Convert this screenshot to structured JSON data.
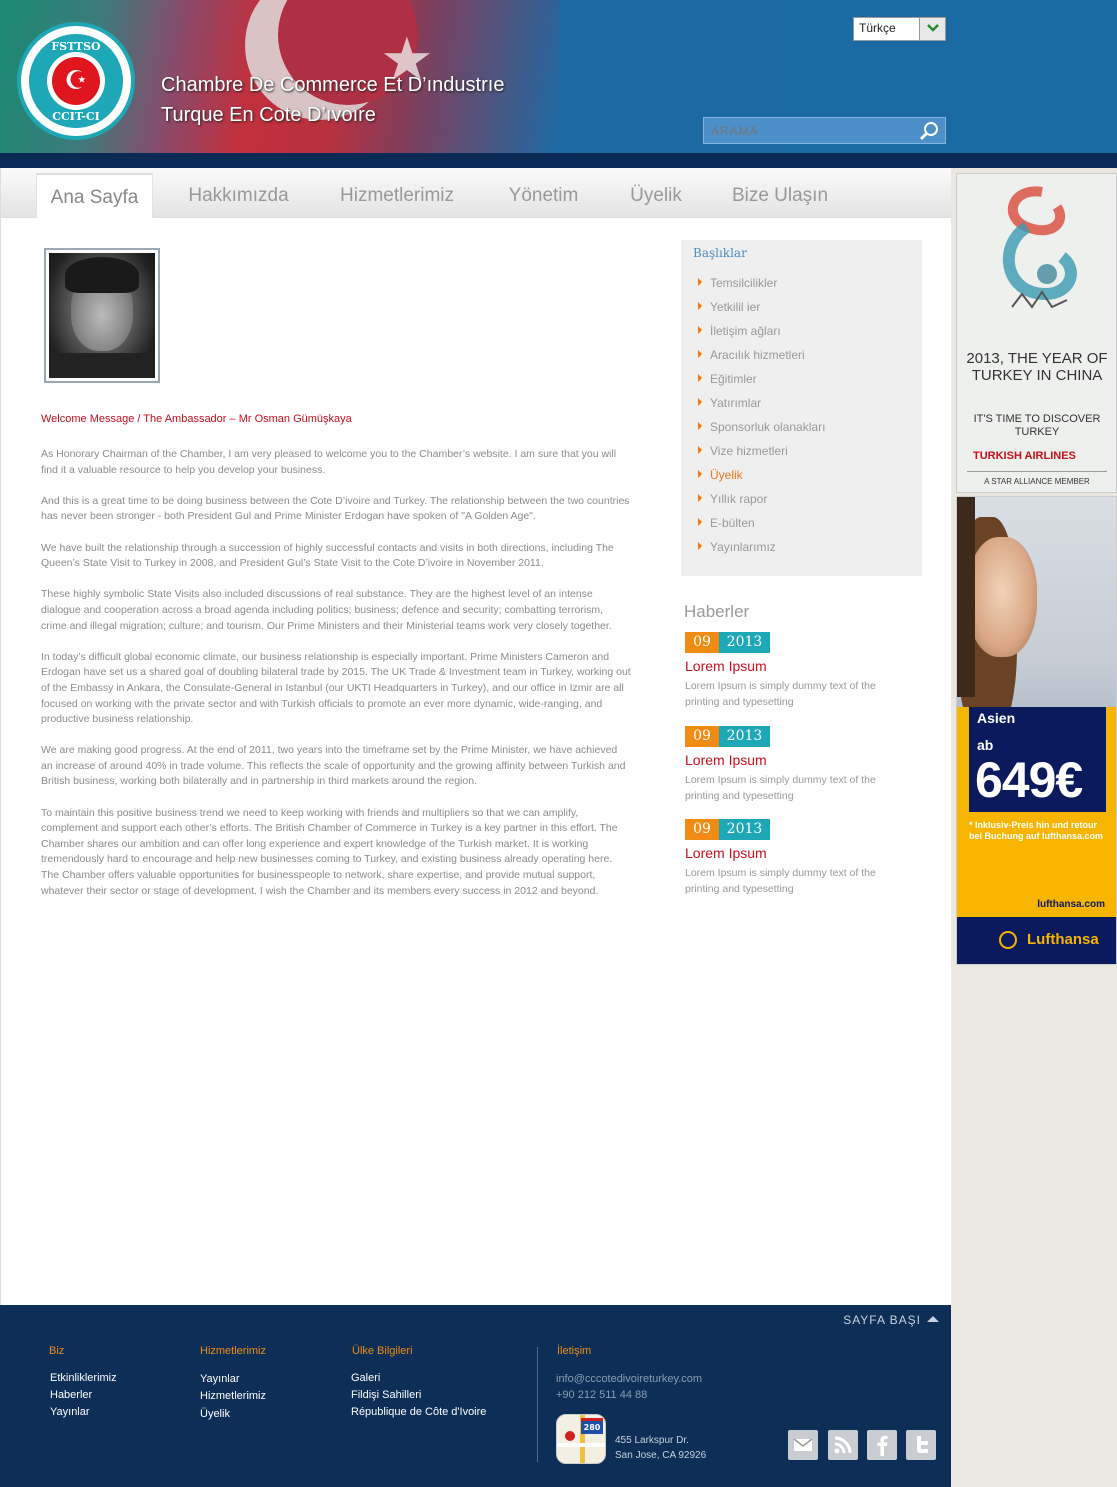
{
  "header": {
    "title_line1": "Chambre De Commerce  Et D’ındustrıe",
    "title_line2": "Turque En Cote D’ıvoıre",
    "logo_top_text": "FSTTSO",
    "logo_bottom_text": "CCIT-CI",
    "language": "Türkçe",
    "search_placeholder": "ARAMA"
  },
  "nav": {
    "items": [
      "Ana Sayfa",
      "Hakkımızda",
      "Hizmetlerimiz",
      "Yönetim",
      "Üyelik",
      "Bize Ulaşın"
    ],
    "active": "Ana Sayfa"
  },
  "article": {
    "title": "Welcome Message / The Ambassador – Mr Osman Gümüşkaya",
    "paragraphs": [
      "As Honorary Chairman of the Chamber, I am very pleased to welcome you to the Chamber’s website. I am sure that you will find it a valuable resource to help you develop your business.",
      "And this is a great time to be doing business between the  Cote D’ivoire and Turkey. The relationship between the two countries has never been stronger - both President Gul and Prime Minister Erdogan have spoken of \"A Golden Age\".",
      "We have built the relationship through a succession of highly successful contacts and visits in both directions, including The Queen’s State Visit to Turkey in 2008, and President Gul’s State Visit to the Cote D’ivoire  in November 2011.",
      "These highly symbolic State Visits also included discussions of real substance. They are the highest level of an intense dialogue and cooperation across a broad agenda including politics; business; defence and security; combatting terrorism, crime and illegal migration; culture; and tourism. Our Prime Ministers and their Ministerial teams work very closely together.",
      "In today’s difficult global economic climate, our business relationship is especially important. Prime Ministers Cameron and Erdogan have set us a shared goal of doubling bilateral trade by 2015. The UK Trade & Investment team in Turkey, working out of the Embassy in Ankara, the Consulate-General in Istanbul (our UKTI Headquarters in Turkey), and our office in Izmir are all focused on working with the private sector and with Turkish officials to promote an ever more dynamic, wide-ranging, and productive business relationship.",
      "We are making good progress. At the end of 2011, two years into the timeframe set by the Prime Minister, we have achieved an increase of around 40% in trade volume. This reflects the scale of opportunity and the growing affinity between Turkish and British business, working both bilaterally and in partnership in third markets around the region.",
      "To maintain this positive business trend we need to keep working with friends and multipliers so that we can amplify, complement and support each other’s efforts. The British Chamber of Commerce in Turkey is a key partner in this effort. The Chamber shares our ambition and can offer long experience and expert knowledge of the Turkish market. It is working tremendously hard to encourage and help new businesses coming to Turkey, and existing business already operating here. The Chamber offers valuable opportunities for businesspeople to network, share expertise, and provide mutual support, whatever their sector or stage of development. I wish the Chamber and its members every success in 2012 and beyond."
    ]
  },
  "sidebar": {
    "title": "Başlıklar",
    "items": [
      "Temsilcilikler",
      "Yetkilil ier",
      "İletişim ağları",
      "Aracılık hizmetleri",
      "Eğitimler",
      "Yatırımlar",
      "Sponsorluk olanakları",
      "Vize hizmetleri",
      "Üyelik",
      "Yıllık rapor",
      "E-bülten",
      "Yayınlarımız"
    ],
    "highlighted": "Üyelik",
    "accent_color": "#e87a1a"
  },
  "news": {
    "heading": "Haberler",
    "items": [
      {
        "day": "09",
        "year": "2013",
        "title": "Lorem Ipsum",
        "text": "Lorem Ipsum is simply dummy text of the printing and typesetting"
      },
      {
        "day": "09",
        "year": "2013",
        "title": "Lorem Ipsum",
        "text": "Lorem Ipsum is simply dummy text of the printing and typesetting"
      },
      {
        "day": "09",
        "year": "2013",
        "title": "Lorem Ipsum",
        "text": "Lorem Ipsum is simply dummy text of the printing and typesetting"
      }
    ]
  },
  "ads": {
    "turkish_airlines": {
      "headline": "2013, THE YEAR OF TURKEY IN CHINA",
      "sub": "IT'S TIME TO DISCOVER TURKEY",
      "brand": "TURKISH AIRLINES",
      "alliance": "A STAR ALLIANCE MEMBER"
    },
    "lufthansa": {
      "region": "Asien",
      "ab": "ab",
      "price": "649€",
      "note": "* Inklusiv-Preis hin und retour bei Buchung auf lufthansa.com",
      "url": "lufthansa.com",
      "brand": "Lufthansa"
    }
  },
  "footer": {
    "to_top": "SAYFA BAŞI",
    "col1": {
      "title": "Biz",
      "links": [
        "Etkinliklerimiz",
        "Haberler",
        "Yayınlar"
      ]
    },
    "col2": {
      "title": "Hizmetlerimiz",
      "links": [
        "Yayınlar",
        "Hizmetlerimiz",
        "Üyelik"
      ]
    },
    "col3": {
      "title": "Ülke Bilgileri",
      "links": [
        "Galeri",
        "Fildişi Sahilleri",
        "République de Côte d'Ivoire"
      ]
    },
    "contact": {
      "title": "İletişim",
      "email": "info@cccotedivoireturkey.com",
      "phone": "+90 212 511 44 88",
      "address_line1": "455 Larkspur Dr.",
      "address_line2": "San Jose, CA 92926",
      "map_badge": "280"
    },
    "social": [
      "mail-icon",
      "rss-icon",
      "facebook-icon",
      "twitter-icon"
    ]
  }
}
